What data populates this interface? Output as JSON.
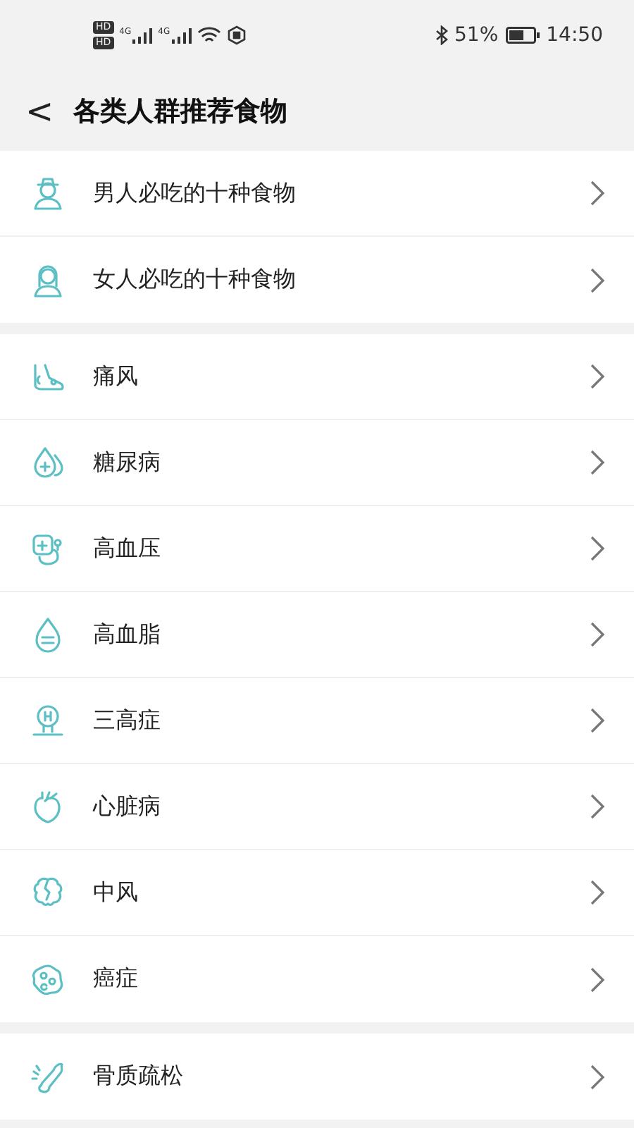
{
  "status_bar": {
    "hd_labels": [
      "HD",
      "HD"
    ],
    "network_labels": [
      "4G",
      "4G"
    ],
    "battery_percent": "51%",
    "time": "14:50"
  },
  "header": {
    "back": "<",
    "title": "各类人群推荐食物"
  },
  "groups": [
    {
      "items": [
        {
          "label": "男人必吃的十种食物"
        },
        {
          "label": "女人必吃的十种食物"
        }
      ]
    },
    {
      "items": [
        {
          "label": "痛风"
        },
        {
          "label": "糖尿病"
        },
        {
          "label": "高血压"
        },
        {
          "label": "高血脂"
        },
        {
          "label": "三高症"
        },
        {
          "label": "心脏病"
        },
        {
          "label": "中风"
        },
        {
          "label": "癌症"
        }
      ]
    },
    {
      "items": [
        {
          "label": "骨质疏松"
        }
      ]
    }
  ]
}
